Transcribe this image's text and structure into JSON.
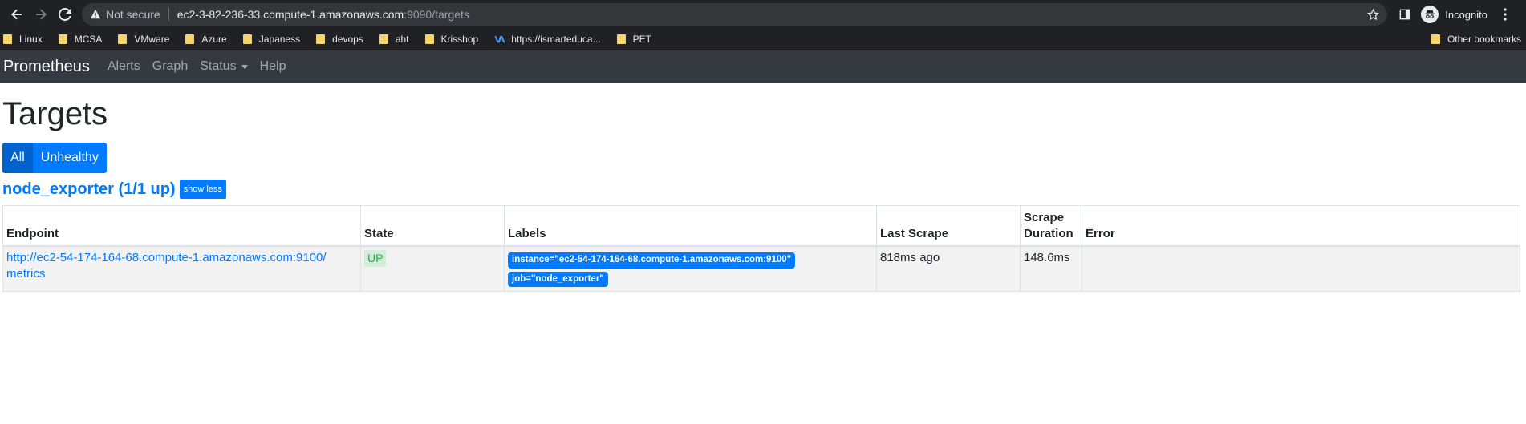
{
  "browser": {
    "not_secure": "Not secure",
    "url_host": "ec2-3-82-236-33.compute-1.amazonaws.com",
    "url_rest": ":9090/targets",
    "profile": "Incognito",
    "bookmarks": [
      "Linux",
      "MCSA",
      "VMware",
      "Azure",
      "Japaness",
      "devops",
      "aht",
      "Krisshop"
    ],
    "bookmark_link": "https://ismarteduca...",
    "bookmark_pet": "PET",
    "other_bookmarks": "Other bookmarks"
  },
  "navbar": {
    "brand": "Prometheus",
    "alerts": "Alerts",
    "graph": "Graph",
    "status": "Status",
    "help": "Help"
  },
  "page": {
    "title": "Targets",
    "filter_all": "All",
    "filter_unhealthy": "Unhealthy"
  },
  "job": {
    "title": "node_exporter (1/1 up)",
    "toggle": "show less"
  },
  "table": {
    "headers": {
      "endpoint": "Endpoint",
      "state": "State",
      "labels": "Labels",
      "last_scrape": "Last Scrape",
      "scrape_duration_line1": "Scrape",
      "scrape_duration_line2": "Duration",
      "error": "Error"
    },
    "rows": [
      {
        "endpoint_line1": "http://ec2-54-174-164-68.compute-1.amazonaws.com:9100/",
        "endpoint_line2": "metrics",
        "state": "UP",
        "label_instance": "instance=\"ec2-54-174-164-68.compute-1.amazonaws.com:9100\"",
        "label_job": "job=\"node_exporter\"",
        "last_scrape": "818ms ago",
        "scrape_duration": "148.6ms",
        "error": ""
      }
    ]
  },
  "colors": {
    "link": "#007bff",
    "navbar_bg": "#343a40",
    "up_badge_bg": "#d4edda",
    "up_badge_text": "#28a745"
  }
}
